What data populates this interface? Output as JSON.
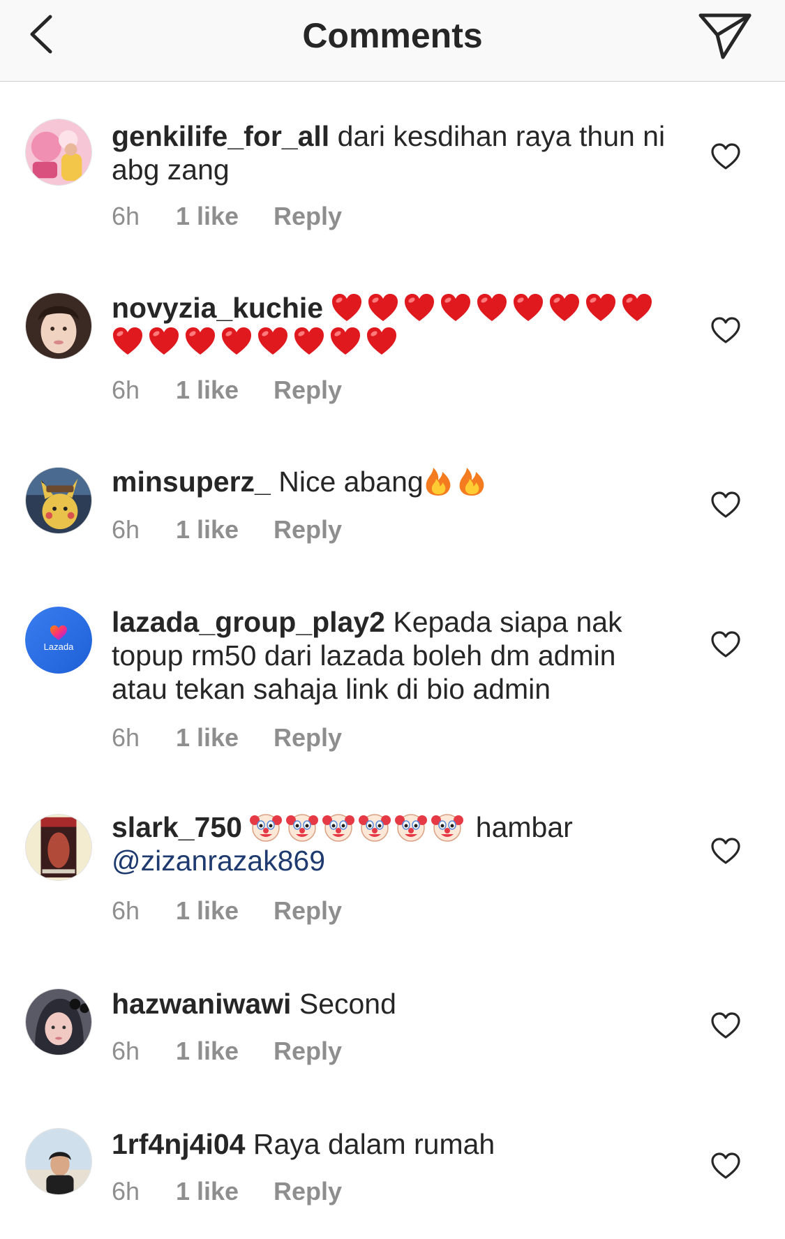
{
  "header": {
    "title": "Comments",
    "back_icon": "chevron-left-icon",
    "send_icon": "paper-plane-icon"
  },
  "colors": {
    "text": "#262626",
    "meta": "#8e8e8e",
    "mention": "#1e3a6e",
    "header_bg": "#f9f9f9"
  },
  "comments": [
    {
      "username": "genkilife_for_all",
      "text": "dari kesdihan raya thun ni abg zang",
      "time": "6h",
      "likes": "1 like",
      "reply": "Reply"
    },
    {
      "username": "novyzia_kuchie",
      "text": "",
      "emoji": "red-heart",
      "emoji_count": 17,
      "time": "6h",
      "likes": "1 like",
      "reply": "Reply"
    },
    {
      "username": "minsuperz_",
      "text": "Nice abang",
      "emoji": "fire",
      "emoji_count": 2,
      "time": "6h",
      "likes": "1 like",
      "reply": "Reply"
    },
    {
      "username": "lazada_group_play2",
      "text": "Kepada siapa nak topup rm50 dari lazada boleh dm admin atau tekan sahaja link di bio admin",
      "avatar_label": "Lazada",
      "time": "6h",
      "likes": "1 like",
      "reply": "Reply"
    },
    {
      "username": "slark_750",
      "emoji": "clown-face",
      "emoji_count": 6,
      "text_after": "hambar",
      "mention": "@zizanrazak869",
      "time": "6h",
      "likes": "1 like",
      "reply": "Reply"
    },
    {
      "username": "hazwaniwawi",
      "text": "Second",
      "time": "6h",
      "likes": "1 like",
      "reply": "Reply"
    },
    {
      "username": "1rf4nj4i04",
      "text": "Raya dalam rumah",
      "time": "6h",
      "likes": "1 like",
      "reply": "Reply"
    }
  ]
}
